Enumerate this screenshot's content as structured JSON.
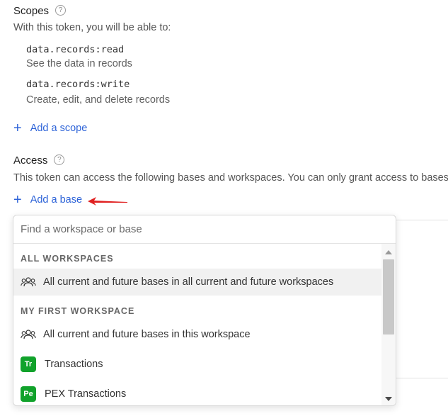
{
  "scopes": {
    "title": "Scopes",
    "help_icon": "?",
    "description": "With this token, you will be able to:",
    "items": [
      {
        "name": "data.records:read",
        "description": "See the data in records"
      },
      {
        "name": "data.records:write",
        "description": "Create, edit, and delete records"
      }
    ],
    "add_label": "Add a scope"
  },
  "access": {
    "title": "Access",
    "help_icon": "?",
    "description": "This token can access the following bases and workspaces. You can only grant access to bases a",
    "add_label": "Add a base"
  },
  "dropdown": {
    "search_placeholder": "Find a workspace or base",
    "groups": [
      {
        "header": "ALL WORKSPACES",
        "items": [
          {
            "icon": "people-icon",
            "label": "All current and future bases in all current and future workspaces"
          }
        ]
      },
      {
        "header": "MY FIRST WORKSPACE",
        "items": [
          {
            "icon": "people-icon",
            "label": "All current and future bases in this workspace"
          },
          {
            "icon": "base-badge",
            "badge": "Tr",
            "label": "Transactions"
          },
          {
            "icon": "base-badge",
            "badge": "Pe",
            "label": "PEX Transactions"
          }
        ]
      }
    ]
  },
  "colors": {
    "link": "#2d63d8",
    "badge": "#11a22b",
    "annotation_arrow": "#e02020"
  }
}
